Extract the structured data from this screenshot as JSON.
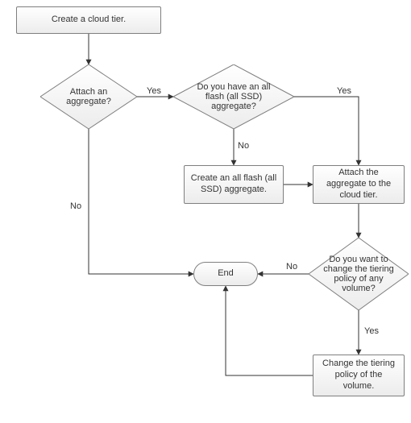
{
  "chart_data": {
    "type": "flowchart",
    "nodes": [
      {
        "id": "n1",
        "kind": "process",
        "text": "Create a cloud tier."
      },
      {
        "id": "n2",
        "kind": "decision",
        "text": "Attach an aggregate?"
      },
      {
        "id": "n3",
        "kind": "decision",
        "text": "Do you have an all flash (all SSD) aggregate?"
      },
      {
        "id": "n4",
        "kind": "process",
        "text": "Create an all flash (all SSD) aggregate."
      },
      {
        "id": "n5",
        "kind": "process",
        "text": "Attach the aggregate to the cloud tier."
      },
      {
        "id": "n6",
        "kind": "decision",
        "text": "Do you want to change the tiering policy of any volume?"
      },
      {
        "id": "n7",
        "kind": "process",
        "text": "Change the tiering policy of the volume."
      },
      {
        "id": "n8",
        "kind": "terminator",
        "text": "End"
      }
    ],
    "edges": [
      {
        "from": "n1",
        "to": "n2",
        "label": ""
      },
      {
        "from": "n2",
        "to": "n3",
        "label": "Yes"
      },
      {
        "from": "n2",
        "to": "n8",
        "label": "No"
      },
      {
        "from": "n3",
        "to": "n5",
        "label": "Yes"
      },
      {
        "from": "n3",
        "to": "n4",
        "label": "No"
      },
      {
        "from": "n4",
        "to": "n5",
        "label": ""
      },
      {
        "from": "n5",
        "to": "n6",
        "label": ""
      },
      {
        "from": "n6",
        "to": "n8",
        "label": "No"
      },
      {
        "from": "n6",
        "to": "n7",
        "label": "Yes"
      },
      {
        "from": "n7",
        "to": "n8",
        "label": ""
      }
    ]
  },
  "labels": {
    "yes": "Yes",
    "no": "No"
  }
}
